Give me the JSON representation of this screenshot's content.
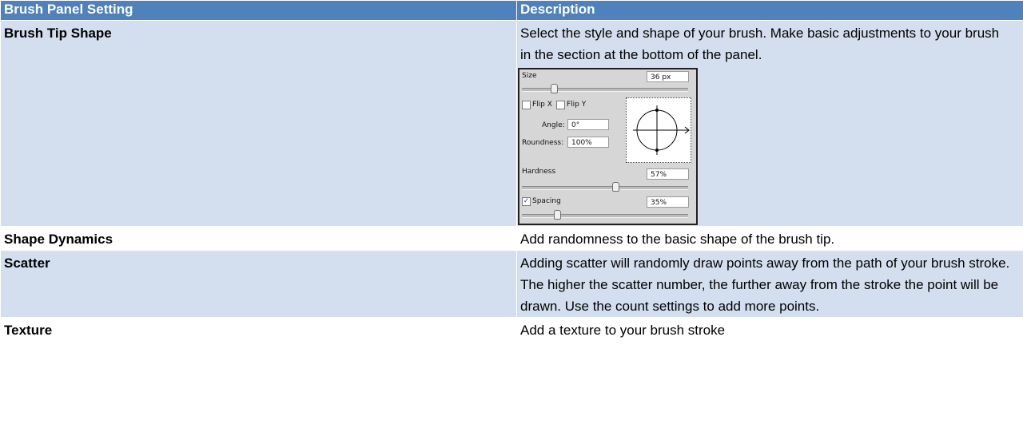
{
  "table": {
    "headers": [
      "Brush Panel Setting",
      "Description"
    ],
    "rows": [
      {
        "setting": "Brush Tip Shape",
        "description": "Select the style and shape of your brush.  Make basic adjustments to your brush in the section at the bottom of the panel."
      },
      {
        "setting": "Shape Dynamics",
        "description": "Add randomness to the basic shape of the brush tip."
      },
      {
        "setting": "Scatter",
        "description": "Adding scatter will randomly draw points away from the path of your brush stroke.  The higher the scatter number, the further away from the stroke the point will be drawn.  Use the count settings to add more points."
      },
      {
        "setting": "Texture",
        "description": "Add a texture to your brush stroke"
      }
    ]
  },
  "brush_panel": {
    "size_label": "Size",
    "size_value": "36 px",
    "size_level": 0.18,
    "flip_x_label": "Flip X",
    "flip_x_checked": false,
    "flip_y_label": "Flip Y",
    "flip_y_checked": false,
    "angle_label": "Angle:",
    "angle_value": "0°",
    "roundness_label": "Roundness:",
    "roundness_value": "100%",
    "hardness_label": "Hardness",
    "hardness_value": "57%",
    "hardness_level": 0.57,
    "spacing_label": "Spacing",
    "spacing_checked": true,
    "spacing_value": "35%",
    "spacing_level": 0.2,
    "check_glyph": "✓"
  },
  "colors": {
    "header": "#4f81bd",
    "band": "#d3dfee",
    "plain": "#ffffff"
  }
}
